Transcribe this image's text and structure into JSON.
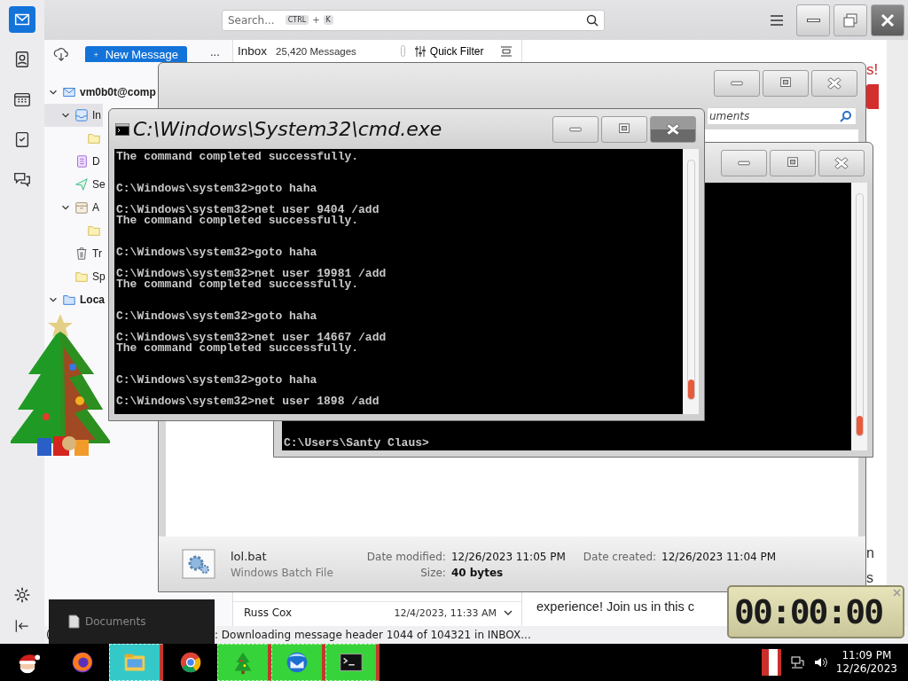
{
  "mail_app": {
    "rail": [
      {
        "kind": "mail",
        "selected": true
      },
      {
        "kind": "contacts",
        "selected": false
      },
      {
        "kind": "calendar",
        "selected": false
      },
      {
        "kind": "tasks",
        "selected": false
      },
      {
        "kind": "chat",
        "selected": false
      }
    ],
    "search": {
      "placeholder": "Search...",
      "keys": [
        "CTRL",
        "+",
        "K"
      ]
    },
    "new_message": "New Message",
    "more": "...",
    "folders": [
      {
        "label": "vm0b0t@comp",
        "kind": "account",
        "expanded": true,
        "selected": false,
        "children": [
          {
            "label": "In",
            "kind": "inbox",
            "expanded": true,
            "selected": true,
            "children": [
              {
                "kind": "folder",
                "selected": false
              }
            ]
          },
          {
            "label": "D",
            "kind": "drafts",
            "selected": false
          },
          {
            "label": "Se",
            "kind": "sent",
            "selected": false
          },
          {
            "label": "A",
            "kind": "archive",
            "expanded": true,
            "selected": false,
            "children": [
              {
                "kind": "folder",
                "selected": false
              }
            ]
          },
          {
            "label": "Tr",
            "kind": "trash",
            "selected": false
          },
          {
            "label": "Sp",
            "kind": "folder",
            "selected": false
          }
        ]
      },
      {
        "label": "Loca",
        "kind": "local",
        "expanded": true,
        "selected": false
      }
    ],
    "message_list": {
      "pin_toggle": {
        "on": false
      },
      "folder": "Inbox",
      "count": "25,420 Messages",
      "quick_filter": "Quick Filter",
      "rows": [
        {
          "sender": "Russ Cox",
          "date": "12/4/2023, 11:33 AM"
        }
      ]
    },
    "reading_pane": {
      "top_fragment": "s!",
      "side_fragments": [
        "n",
        "s"
      ],
      "text": "experience! Join us in this c"
    },
    "status": {
      "prefix": "(",
      "text": ": Downloading message header 1044 of 104321 in INBOX..."
    }
  },
  "explorer": {
    "search_text": "uments",
    "file": {
      "name": "lol.bat",
      "type": "Windows Batch File",
      "details": [
        {
          "label": "Date modified:",
          "value": "12/26/2023 11:05 PM"
        },
        {
          "label": "Size:",
          "value": "40 bytes"
        },
        {
          "label": "Date created:",
          "value": "12/26/2023 11:04 PM"
        }
      ]
    }
  },
  "console_back": {
    "lines": [
      "C:\\Users\\Santy Claus>"
    ]
  },
  "console": {
    "title": "C:\\Windows\\System32\\cmd.exe",
    "lines": [
      {
        "kind": "output",
        "text": "The command completed successfully."
      },
      {
        "kind": "prompt",
        "text": "C:\\Windows\\system32>goto haha"
      },
      {
        "kind": "prompt",
        "text": "C:\\Windows\\system32>net user 9404 /add"
      },
      {
        "kind": "output",
        "text": "The command completed successfully."
      },
      {
        "kind": "prompt",
        "text": "C:\\Windows\\system32>goto haha"
      },
      {
        "kind": "prompt",
        "text": "C:\\Windows\\system32>net user 19981 /add"
      },
      {
        "kind": "output",
        "text": "The command completed successfully."
      },
      {
        "kind": "prompt",
        "text": "C:\\Windows\\system32>goto haha"
      },
      {
        "kind": "prompt",
        "text": "C:\\Windows\\system32>net user 14667 /add"
      },
      {
        "kind": "output",
        "text": "The command completed successfully."
      },
      {
        "kind": "prompt",
        "text": "C:\\Windows\\system32>goto haha"
      },
      {
        "kind": "prompt",
        "text": "C:\\Windows\\system32>net user 1898 /add"
      }
    ]
  },
  "thumbnail": {
    "label": "Documents"
  },
  "timer": {
    "display": "00:00:00"
  },
  "taskbar": {
    "apps": [
      {
        "kind": "santa",
        "selected": false,
        "running": false
      },
      {
        "kind": "firefox",
        "selected": false,
        "running": false
      },
      {
        "kind": "explorer",
        "selected": true,
        "running": true
      },
      {
        "kind": "chrome",
        "selected": false,
        "running": false
      },
      {
        "kind": "tree",
        "selected": false,
        "running": true
      },
      {
        "kind": "thunderbird",
        "selected": false,
        "running": true
      },
      {
        "kind": "terminal",
        "selected": false,
        "running": true
      }
    ],
    "time": "11:09 PM",
    "date": "12/26/2023"
  }
}
